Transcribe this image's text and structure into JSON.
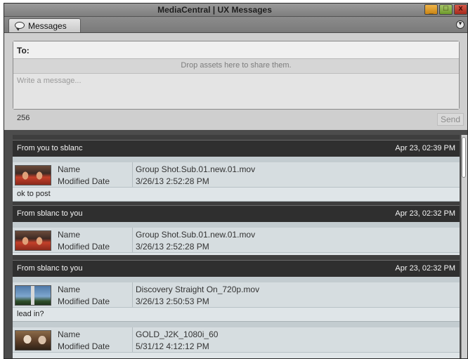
{
  "window": {
    "title": "MediaCentral | UX Messages",
    "controls": {
      "minimize": "_",
      "maximize": "□",
      "close": "x"
    }
  },
  "tab": {
    "label": "Messages",
    "icon": "speech-bubble-icon"
  },
  "panel_menu": {
    "icon": "chevron-down-icon",
    "glyph": "▾"
  },
  "compose": {
    "to_label": "To:",
    "drop_hint": "Drop assets here to share them.",
    "message_placeholder": "Write a message...",
    "char_count": "256",
    "send_label": "Send"
  },
  "messages": [
    {
      "from": "From you to sblanc",
      "date": "Apr 23, 02:39 PM",
      "asset": {
        "name_label": "Name",
        "name": "Group Shot.Sub.01.new.01.mov",
        "modified_label": "Modified Date",
        "modified": "3/26/13 2:52:28 PM",
        "thumbnail": "crew-thumbnail"
      },
      "text": "ok to post"
    },
    {
      "from": "From sblanc to you",
      "date": "Apr 23, 02:32 PM",
      "asset": {
        "name_label": "Name",
        "name": "Group Shot.Sub.01.new.01.mov",
        "modified_label": "Modified Date",
        "modified": "3/26/13 2:52:28 PM",
        "thumbnail": "crew-thumbnail"
      },
      "text": ""
    },
    {
      "from": "From sblanc to you",
      "date": "Apr 23, 02:32 PM",
      "asset": {
        "name_label": "Name",
        "name": "Discovery Straight On_720p.mov",
        "modified_label": "Modified Date",
        "modified": "3/26/13 2:50:53 PM",
        "thumbnail": "launch-thumbnail"
      },
      "text": "lead in?",
      "asset2": {
        "name_label": "Name",
        "name": "GOLD_J2K_1080i_60",
        "modified_label": "Modified Date",
        "modified": "5/31/12 4:12:12 PM",
        "thumbnail": "gold-thumbnail"
      }
    }
  ],
  "colors": {
    "chrome": "#4c4c4c",
    "header_bar": "#2f2f2f",
    "asset_row": "#d6dde0",
    "compose_bg": "#cfcfcf",
    "close_button": "#c0392b",
    "minimize_button": "#e0a030",
    "maximize_button": "#8ab04a"
  }
}
